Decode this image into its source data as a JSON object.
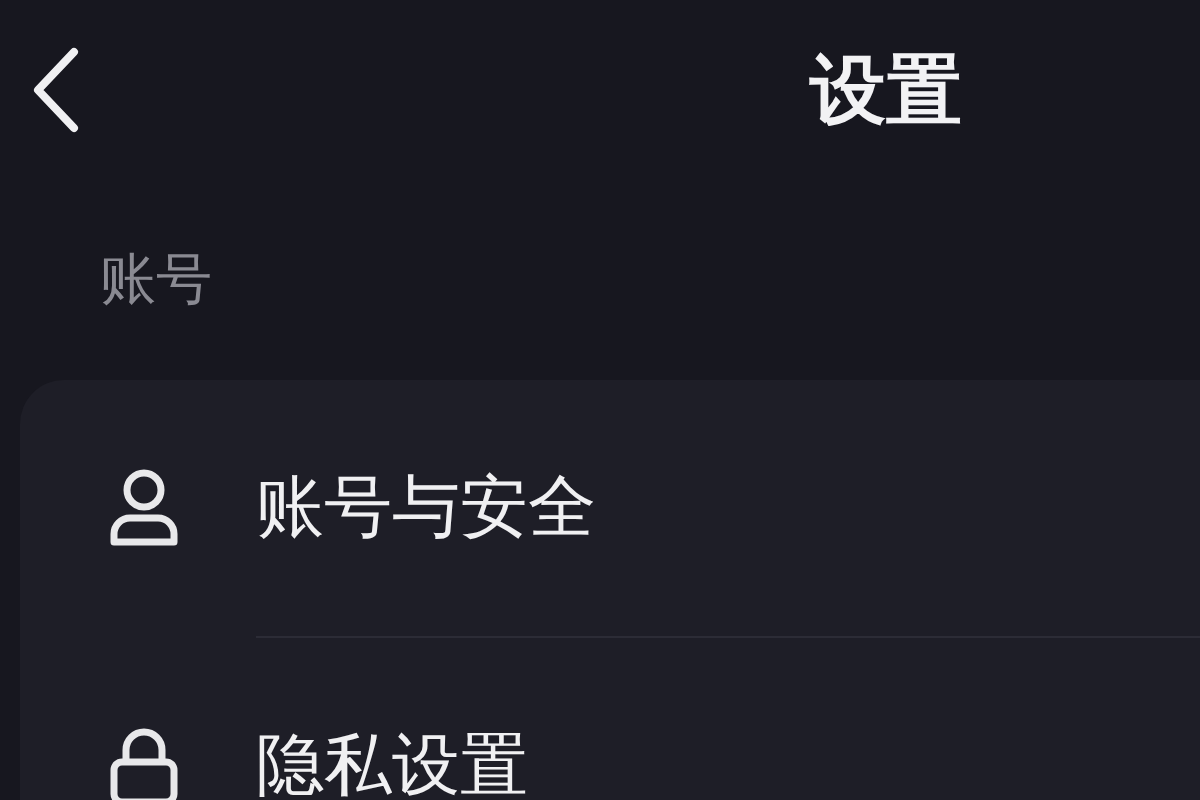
{
  "header": {
    "title": "设置"
  },
  "section": {
    "label": "账号"
  },
  "items": [
    {
      "kind": "account",
      "label": "账号与安全"
    },
    {
      "kind": "privacy",
      "label": "隐私设置"
    }
  ]
}
